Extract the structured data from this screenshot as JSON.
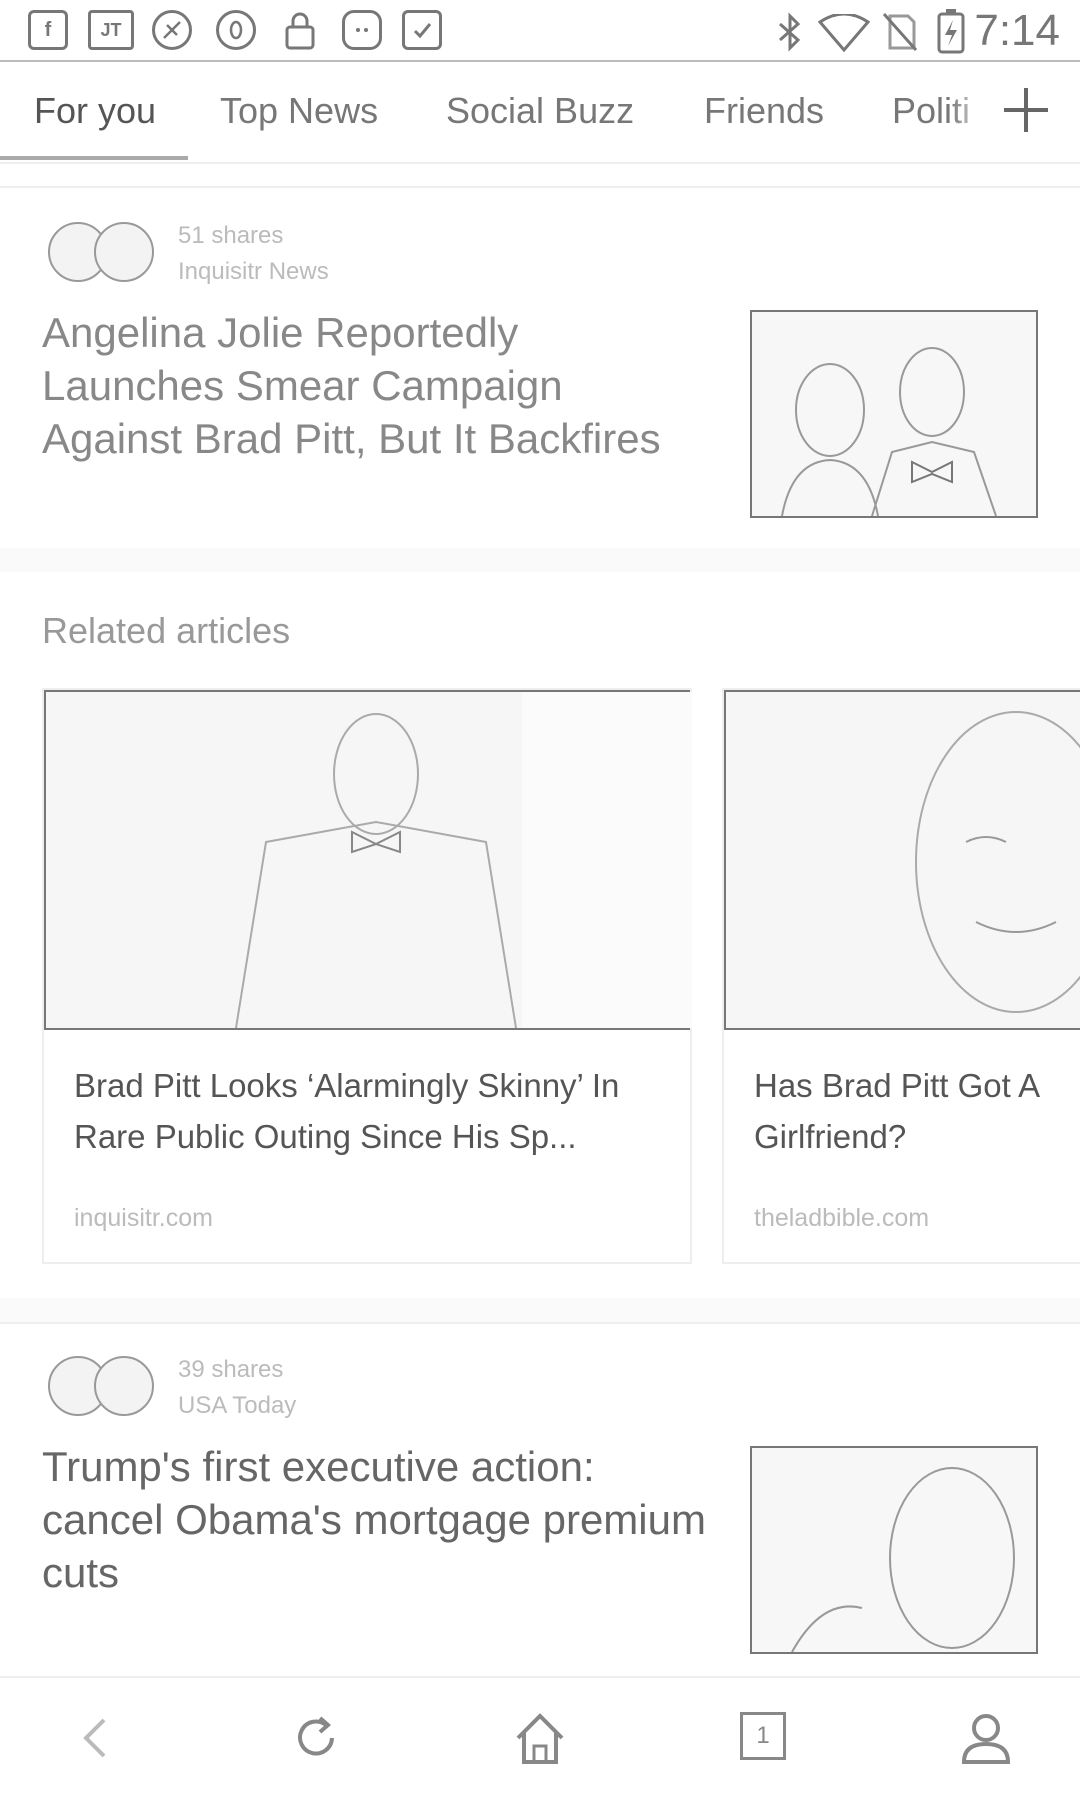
{
  "status_bar": {
    "time": "7:14",
    "left_icons": [
      "facebook-icon",
      "jt-app-icon",
      "app-icon",
      "opera-icon",
      "lock-icon",
      "android-icon",
      "clipboard-check-icon"
    ],
    "right_icons": [
      "bluetooth-icon",
      "wifi-icon",
      "no-sim-icon",
      "battery-charging-icon"
    ]
  },
  "tabs": [
    "For you",
    "Top News",
    "Social Buzz",
    "Friends",
    "Politi"
  ],
  "articles": [
    {
      "shares": "51 shares",
      "source": "Inquisitr News",
      "headline": "Angelina Jolie Reportedly Launches Smear Campaign Against Brad Pitt, But It Backfires"
    },
    {
      "shares": "39 shares",
      "source": "USA Today",
      "headline": "Trump's first executive action: cancel Obama's mortgage premium cuts"
    }
  ],
  "related": {
    "title": "Related articles",
    "cards": [
      {
        "title": "Brad Pitt Looks ‘Alarmingly Skinny’ In Rare Public Outing Since His Sp...",
        "source": "inquisitr.com"
      },
      {
        "title": "Has Brad Pitt Got A Girlfriend?",
        "source": "theladbible.com"
      }
    ]
  },
  "bottom_nav": {
    "tab_count": "1",
    "icons": [
      "back-icon",
      "refresh-icon",
      "home-icon",
      "tabs-icon",
      "profile-icon"
    ]
  }
}
